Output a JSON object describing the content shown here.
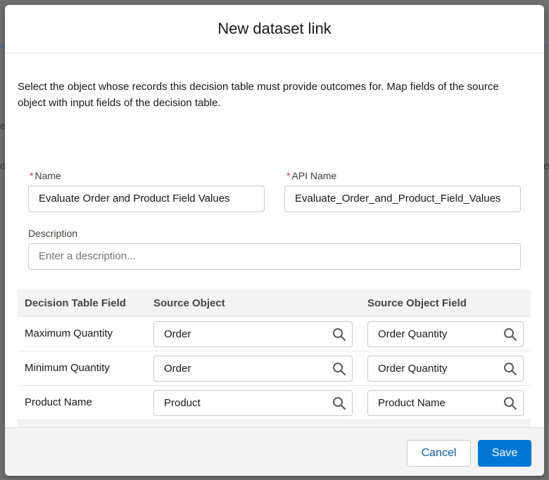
{
  "background": {
    "letters": [
      "e",
      "d",
      "e"
    ]
  },
  "modal": {
    "title": "New dataset link",
    "intro": "Select the object whose records this decision table must provide outcomes for. Map fields of the source object with input fields of the decision table.",
    "required_marker": "*",
    "name_label": "Name",
    "name_value": "Evaluate Order and Product Field Values",
    "api_name_label": "API Name",
    "api_name_value": "Evaluate_Order_and_Product_Field_Values",
    "description_label": "Description",
    "description_placeholder": "Enter a description...",
    "table": {
      "headers": [
        "Decision Table Field",
        "Source Object",
        "Source Object Field"
      ],
      "rows": [
        {
          "field": "Maximum Quantity",
          "source_object": "Order",
          "source_field": "Order Quantity"
        },
        {
          "field": "Minimum Quantity",
          "source_object": "Order",
          "source_field": "Order Quantity"
        },
        {
          "field": "Product Name",
          "source_object": "Product",
          "source_field": "Product Name"
        }
      ]
    },
    "footer": {
      "cancel_label": "Cancel",
      "save_label": "Save"
    }
  },
  "colors": {
    "brand": "#0176d3",
    "required": "#c23934",
    "link": "#0b5cab"
  },
  "icons": {
    "lookup": "search-icon"
  }
}
